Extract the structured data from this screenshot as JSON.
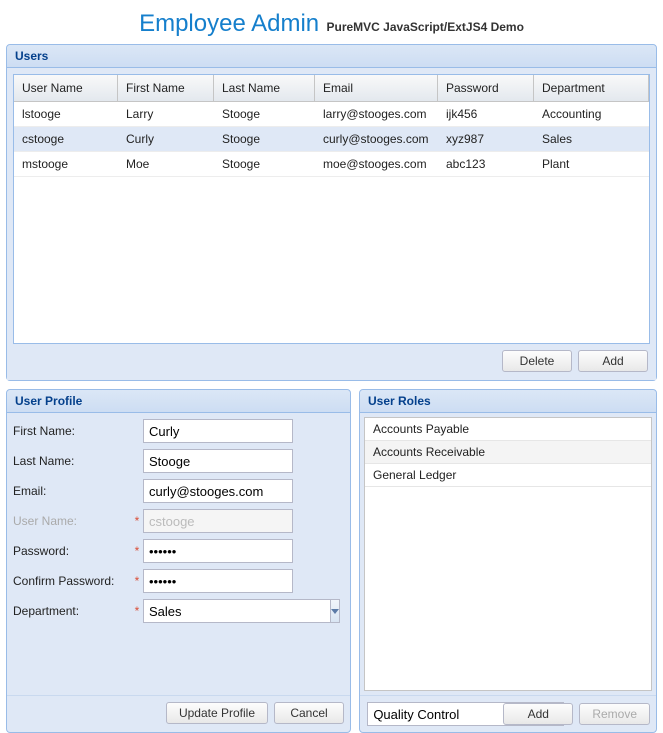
{
  "header": {
    "title": "Employee Admin",
    "subtitle": "PureMVC JavaScript/ExtJS4 Demo"
  },
  "users_panel": {
    "title": "Users",
    "columns": [
      "User Name",
      "First Name",
      "Last Name",
      "Email",
      "Password",
      "Department"
    ],
    "rows": [
      {
        "uname": "lstooge",
        "fname": "Larry",
        "lname": "Stooge",
        "email": "larry@stooges.com",
        "pwd": "ijk456",
        "dept": "Accounting",
        "selected": false
      },
      {
        "uname": "cstooge",
        "fname": "Curly",
        "lname": "Stooge",
        "email": "curly@stooges.com",
        "pwd": "xyz987",
        "dept": "Sales",
        "selected": true
      },
      {
        "uname": "mstooge",
        "fname": "Moe",
        "lname": "Stooge",
        "email": "moe@stooges.com",
        "pwd": "abc123",
        "dept": "Plant",
        "selected": false
      }
    ],
    "delete_label": "Delete",
    "add_label": "Add"
  },
  "profile_panel": {
    "title": "User Profile",
    "labels": {
      "fname": "First Name:",
      "lname": "Last Name:",
      "email": "Email:",
      "uname": "User Name:",
      "pwd": "Password:",
      "cpwd": "Confirm Password:",
      "dept": "Department:"
    },
    "values": {
      "fname": "Curly",
      "lname": "Stooge",
      "email": "curly@stooges.com",
      "uname": "cstooge",
      "pwd": "••••••",
      "cpwd": "••••••",
      "dept": "Sales"
    },
    "update_label": "Update Profile",
    "cancel_label": "Cancel"
  },
  "roles_panel": {
    "title": "User Roles",
    "items": [
      "Accounts Payable",
      "Accounts Receivable",
      "General Ledger"
    ],
    "combo_value": "Quality Control",
    "add_label": "Add",
    "remove_label": "Remove"
  }
}
